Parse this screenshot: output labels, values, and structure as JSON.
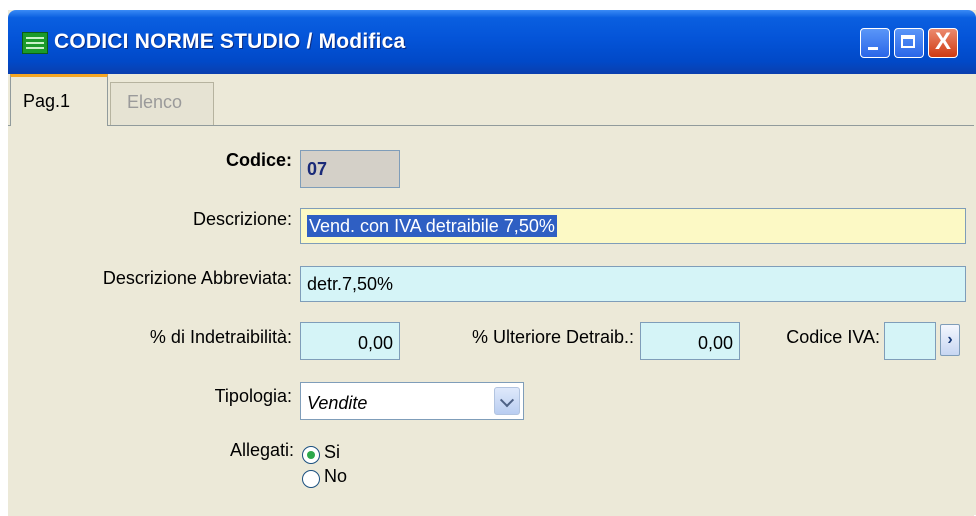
{
  "window": {
    "title": "CODICI NORME STUDIO / Modifica",
    "title_icon": "table-icon",
    "buttons": [
      "minimize-icon",
      "maximize-icon",
      "close-icon"
    ],
    "close_glyph": "X"
  },
  "tabs": [
    {
      "label": "Pag.1",
      "active": true
    },
    {
      "label": "Elenco",
      "active": false
    }
  ],
  "form": {
    "codice": {
      "label": "Codice:",
      "value": "07"
    },
    "descrizione": {
      "label": "Descrizione:",
      "value": "Vend. con IVA detraibile 7,50%"
    },
    "descrizione_abbreviata": {
      "label": "Descrizione Abbreviata:",
      "value": "detr.7,50%"
    },
    "indetraibilita": {
      "label": "% di Indetraibilità:",
      "value": "0,00"
    },
    "ulteriore_detraib": {
      "label": "% Ulteriore Detraib.:",
      "value": "0,00"
    },
    "codice_iva": {
      "label": "Codice IVA:",
      "value": "",
      "button_glyph": "›"
    },
    "tipologia": {
      "label": "Tipologia:",
      "value": "Vendite"
    },
    "allegati": {
      "label": "Allegati:",
      "options": [
        "Si",
        "No"
      ],
      "selected": "Si"
    }
  },
  "colors": {
    "titlebar": "#0454d8",
    "field_bg": "#d5f4f7",
    "focus_field_bg": "#fcf9c5",
    "selection": "#2f5fc3",
    "active_tab_accent": "#f5a623"
  }
}
